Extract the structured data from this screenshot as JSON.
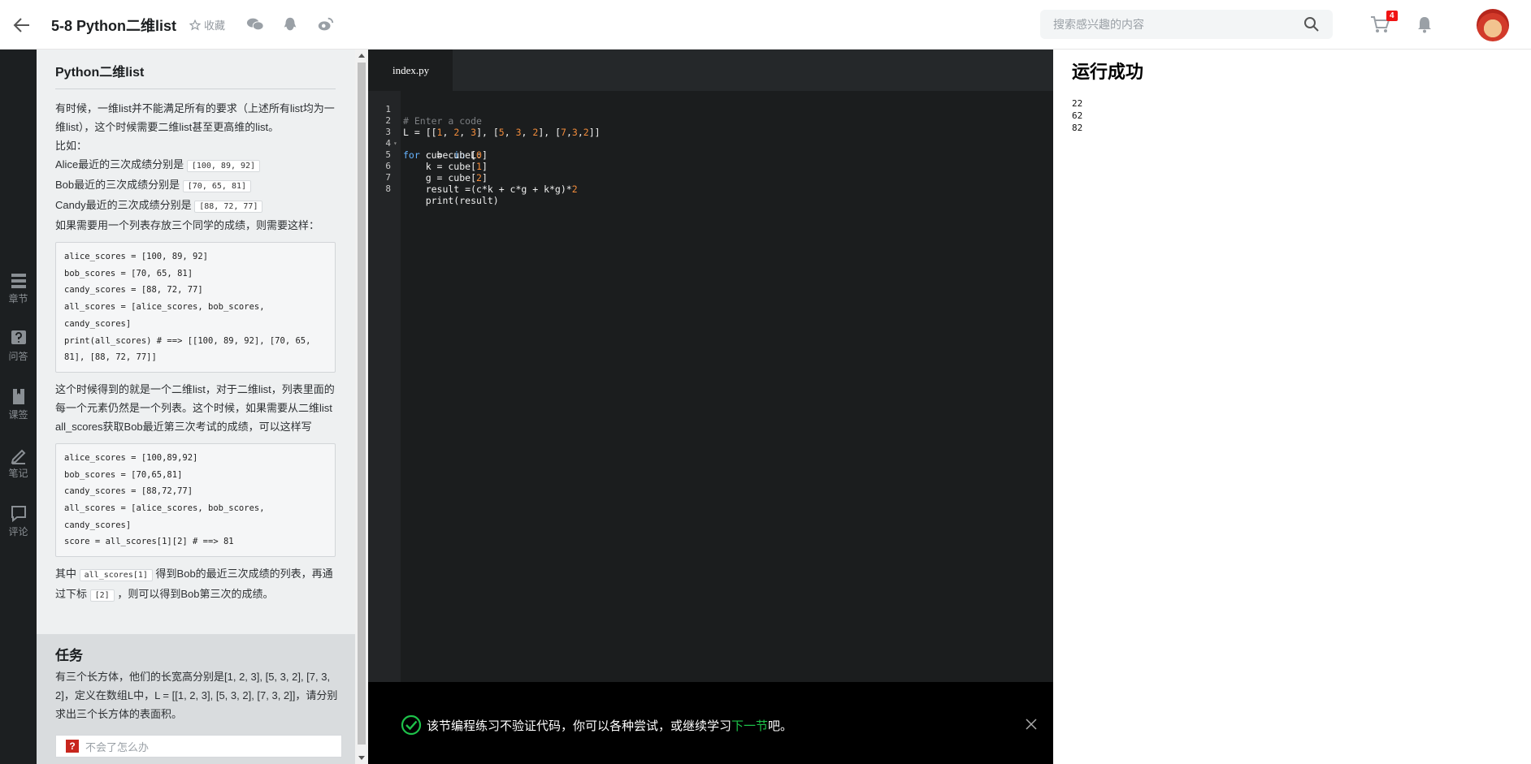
{
  "header": {
    "course_title": "5-8 Python二维list",
    "favorite_label": "收藏",
    "search_placeholder": "搜索感兴趣的内容",
    "cart_count": "4"
  },
  "rail": {
    "items": [
      {
        "label": "章节",
        "icon": "chapter-icon"
      },
      {
        "label": "问答",
        "icon": "question-icon"
      },
      {
        "label": "课签",
        "icon": "bookmark-icon"
      },
      {
        "label": "笔记",
        "icon": "pencil-icon"
      },
      {
        "label": "评论",
        "icon": "comment-icon"
      }
    ]
  },
  "lesson": {
    "title": "Python二维list",
    "intro": "有时候，一维list并不能满足所有的要求（上述所有list均为一维list），这个时候需要二维list甚至更高维的list。",
    "example_lead": "比如：",
    "alice_text": "Alice最近的三次成绩分别是",
    "alice_code": "[100, 89, 92]",
    "bob_text": "Bob最近的三次成绩分别是",
    "bob_code": "[70, 65, 81]",
    "candy_text": "Candy最近的三次成绩分别是",
    "candy_code": "[88, 72, 77]",
    "need_text": "如果需要用一个列表存放三个同学的成绩，则需要这样：",
    "code1": "alice_scores = [100, 89, 92]\nbob_scores = [70, 65, 81]\ncandy_scores = [88, 72, 77]\nall_scores = [alice_scores, bob_scores,\ncandy_scores]\nprint(all_scores) # ==> [[100, 89, 92], [70, 65,\n81], [88, 72, 77]]",
    "explain": "这个时候得到的就是一个二维list，对于二维list，列表里面的每一个元素仍然是一个列表。这个时候，如果需要从二维list all_scores获取Bob最近第三次考试的成绩，可以这样写",
    "code2": "alice_scores = [100,89,92]\nbob_scores = [70,65,81]\ncandy_scores = [88,72,77]\nall_scores = [alice_scores, bob_scores,\ncandy_scores]\nscore = all_scores[1][2] # ==> 81",
    "final_pre": "其中",
    "final_code1": "all_scores[1]",
    "final_mid": "得到Bob的最近三次成绩的列表，再通过下标",
    "final_code2": "[2]",
    "final_post": "，则可以得到Bob第三次的成绩。"
  },
  "task": {
    "heading": "任务",
    "text": "有三个长方体，他们的长宽高分别是[1, 2, 3], [5, 3, 2], [7, 3, 2]，定义在数组L中，L = [[1, 2, 3], [5, 3, 2], [7, 3, 2]]，请分别求出三个长方体的表面积。",
    "help_placeholder": "不会了怎么办"
  },
  "editor": {
    "tab_name": "index.py",
    "line_numbers": [
      "1",
      "2",
      "3",
      "4",
      "5",
      "6",
      "7",
      "8"
    ],
    "fold_marker": "▾",
    "tokens": {
      "comment": "# Enter a code",
      "l1": "L = [[",
      "n1": "1",
      "n2": "2",
      "n3": "3",
      "n5": "5",
      "n3b": "3",
      "n2b": "2",
      "n7": "7",
      "n3c": "3",
      "n2c": "2",
      "kw_for": "for",
      "cube": " cube ",
      "kw_in": "in",
      "L": " L:",
      "c_line_a": "    c = cube[",
      "c_idx": "0",
      "k_line_a": "    k = cube[",
      "k_idx": "1",
      "g_line_a": "    g = cube[",
      "g_idx": "2",
      "res_a": "    result =(c*k + c*g + k*g)*",
      "res_n": "2",
      "print_line": "    print(result)"
    },
    "console_message": "该节编程练习不验证代码，你可以各种尝试，或继续学习",
    "console_link": "下一节",
    "console_suffix": "吧。"
  },
  "output": {
    "title": "运行成功",
    "lines": [
      "22",
      "62",
      "82"
    ]
  },
  "colors": {
    "rail_bg": "#1c1f21",
    "editor_bg": "#1b1d1e",
    "success_green": "#1ec24a",
    "badge_red": "#f01414"
  }
}
